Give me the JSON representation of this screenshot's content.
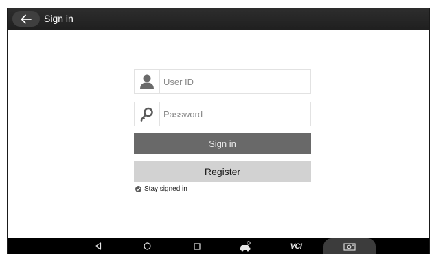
{
  "header": {
    "back_icon": "arrow-left-icon",
    "title": "Sign in"
  },
  "login": {
    "user_id_placeholder": "User ID",
    "user_icon": "person-icon",
    "password_placeholder": "Password",
    "password_icon": "key-icon",
    "signin_label": "Sign in",
    "register_label": "Register",
    "stay_signed_in_label": "Stay signed in",
    "stay_signed_in_checked": true
  },
  "navbar": {
    "items": [
      "back-triangle-icon",
      "home-circle-icon",
      "recents-square-icon",
      "car-diagnostic-icon",
      "vci-icon",
      "screenshot-camera-icon"
    ],
    "vci_text": "VCI"
  },
  "colors": {
    "topbar": "#262626",
    "signin_button": "#696969",
    "register_button": "#d2d2d2",
    "navbar": "#000000"
  }
}
